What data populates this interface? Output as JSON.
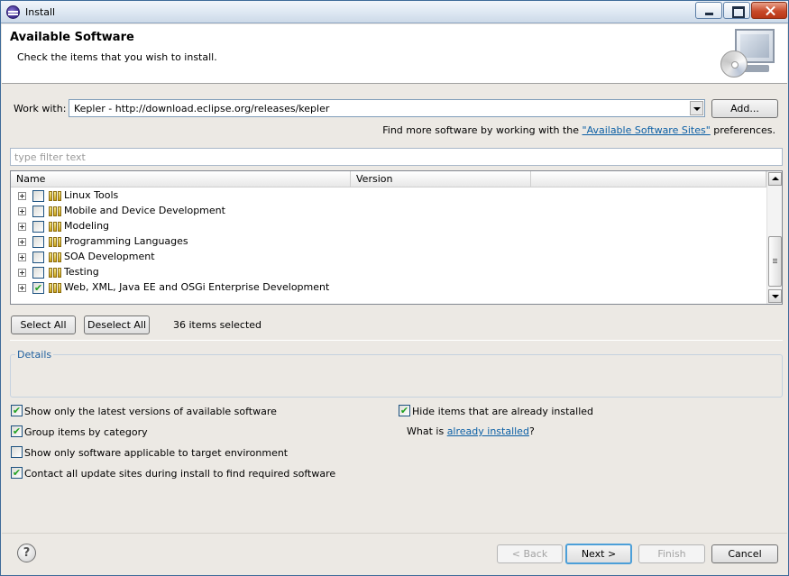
{
  "window": {
    "title": "Install"
  },
  "header": {
    "title": "Available Software",
    "description": "Check the items that you wish to install."
  },
  "work_with": {
    "label": "Work with:",
    "value": "Kepler - http://download.eclipse.org/releases/kepler",
    "add_button": "Add..."
  },
  "find_more": {
    "prefix": "Find more software by working with the ",
    "link": "\"Available Software Sites\"",
    "suffix": " preferences."
  },
  "filter": {
    "placeholder": "type filter text"
  },
  "table": {
    "columns": [
      "Name",
      "Version"
    ],
    "rows": [
      {
        "label": "Linux Tools",
        "checked": false
      },
      {
        "label": "Mobile and Device Development",
        "checked": false
      },
      {
        "label": "Modeling",
        "checked": false
      },
      {
        "label": "Programming Languages",
        "checked": false
      },
      {
        "label": "SOA Development",
        "checked": false
      },
      {
        "label": "Testing",
        "checked": false
      },
      {
        "label": "Web, XML, Java EE and OSGi Enterprise Development",
        "checked": true
      }
    ]
  },
  "selection": {
    "select_all": "Select All",
    "deselect_all": "Deselect All",
    "count_text": "36 items selected"
  },
  "details": {
    "legend": "Details"
  },
  "options": {
    "latest_versions": {
      "label": "Show only the latest versions of available software",
      "checked": true
    },
    "group_by_category": {
      "label": "Group items by category",
      "checked": true
    },
    "target_env": {
      "label": "Show only software applicable to target environment",
      "checked": false
    },
    "contact_sites": {
      "label": "Contact all update sites during install to find required software",
      "checked": true
    },
    "hide_installed": {
      "label": "Hide items that are already installed",
      "checked": true
    },
    "what_is": {
      "prefix": "What is ",
      "link": "already installed",
      "suffix": "?"
    }
  },
  "footer": {
    "help_glyph": "?",
    "back": "< Back",
    "next": "Next >",
    "finish": "Finish",
    "cancel": "Cancel"
  },
  "icons": [
    "eclipse-app-icon",
    "minimize-icon",
    "maximize-icon",
    "close-icon",
    "install-banner-icon",
    "combo-arrow-icon",
    "expand-icon",
    "category-icon",
    "scroll-up-icon",
    "scroll-down-icon",
    "help-icon"
  ]
}
